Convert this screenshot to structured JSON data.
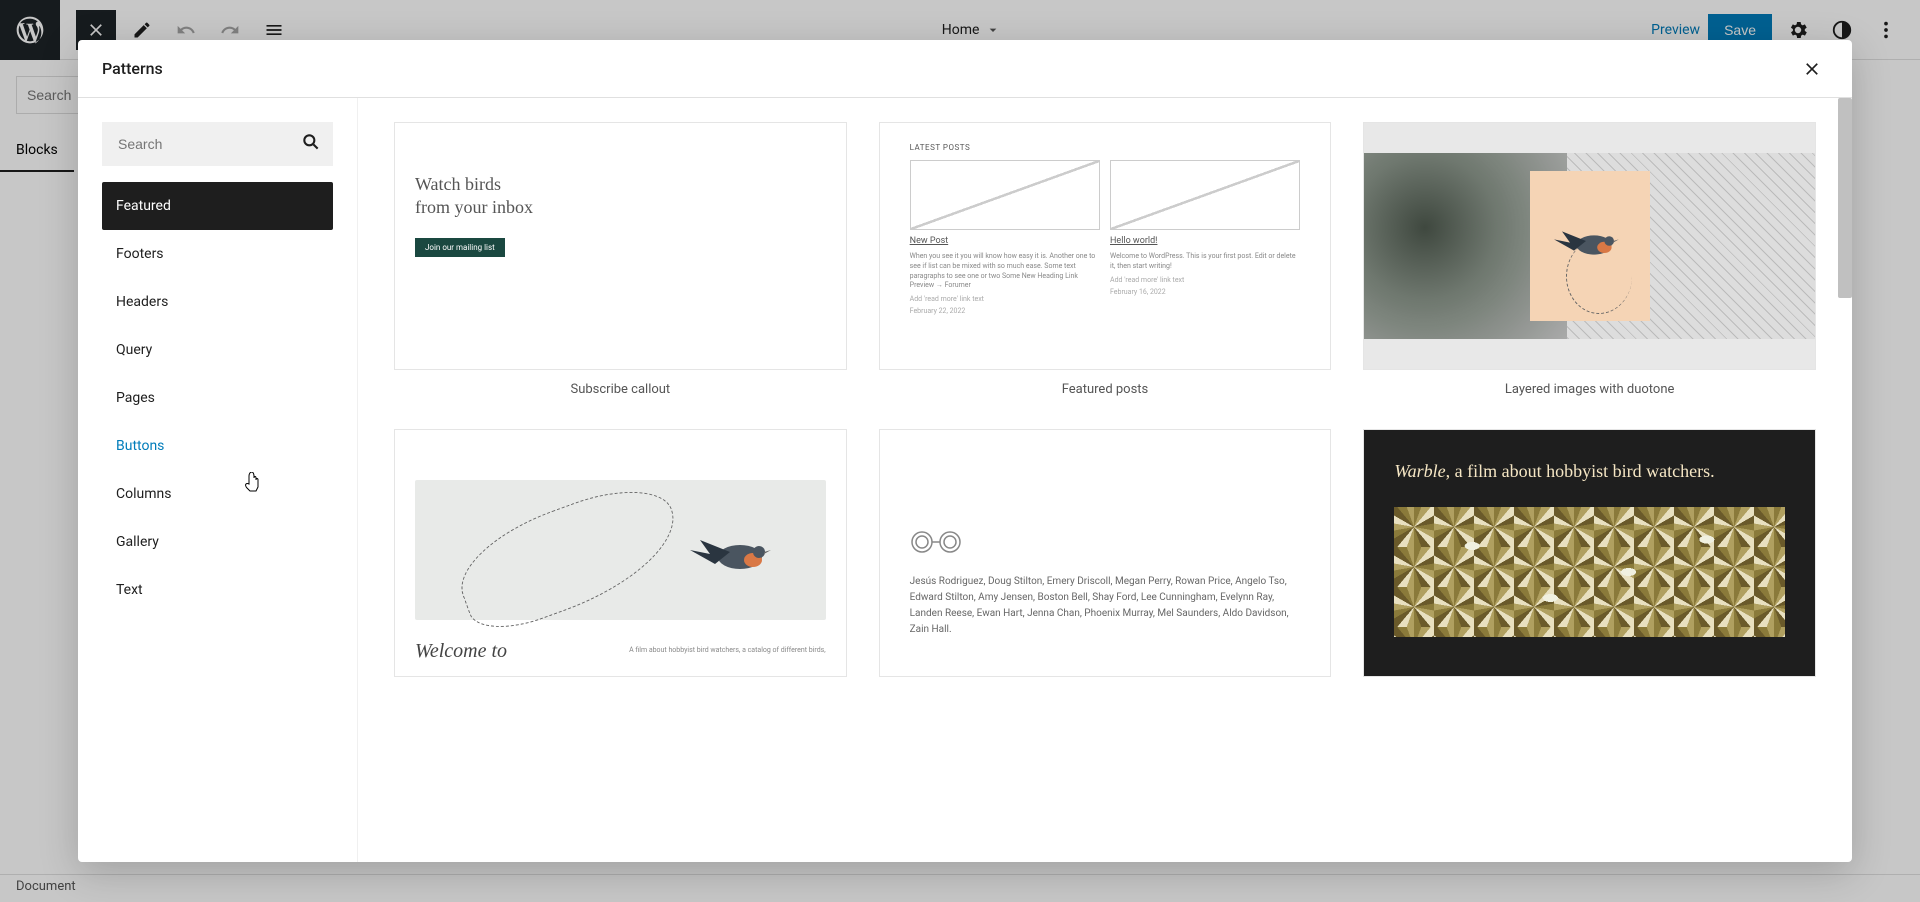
{
  "editor": {
    "page_title": "Home",
    "preview_label": "Preview",
    "save_label": "Save",
    "search_placeholder": "Search",
    "blocks_tab": "Blocks",
    "document_label": "Document",
    "new_post_bg": "New Post"
  },
  "modal": {
    "title": "Patterns",
    "search_placeholder": "Search",
    "categories": [
      {
        "label": "Featured",
        "active": true
      },
      {
        "label": "Footers"
      },
      {
        "label": "Headers"
      },
      {
        "label": "Query"
      },
      {
        "label": "Pages"
      },
      {
        "label": "Buttons",
        "hover": true
      },
      {
        "label": "Columns"
      },
      {
        "label": "Gallery"
      },
      {
        "label": "Text"
      }
    ],
    "patterns": [
      {
        "title": "Subscribe callout",
        "heading_l1": "Watch birds",
        "heading_l2": "from your inbox",
        "button": "Join our mailing list"
      },
      {
        "title": "Featured posts",
        "label": "LATEST POSTS",
        "col1": {
          "title": "New Post",
          "text": "When you see it you will know how easy it is. Another one to see if list can be mixed with so much ease. Some text paragraphs to see one or two Some New Heading Link Preview → Forumer",
          "link": "Add 'read more' link text",
          "date": "February 22, 2022"
        },
        "col2": {
          "title": "Hello world!",
          "text": "Welcome to WordPress. This is your first post. Edit or delete it, then start writing!",
          "link": "Add 'read more' link text",
          "date": "February 16, 2022"
        }
      },
      {
        "title": "Layered images with duotone"
      },
      {
        "title": "",
        "heading": "Welcome to",
        "text": "A film about hobbyist bird watchers, a catalog of different birds,"
      },
      {
        "title": "",
        "names": "Jesús Rodriguez, Doug Stilton, Emery Driscoll, Megan Perry, Rowan Price, Angelo Tso, Edward Stilton, Amy Jensen, Boston Bell, Shay Ford, Lee Cunningham, Evelynn Ray, Landen Reese, Ewan Hart, Jenna Chan, Phoenix Murray, Mel Saunders, Aldo Davidson, Zain Hall."
      },
      {
        "title": "",
        "heading_em": "Warble",
        "heading_rest": ", a film about hobbyist bird watchers."
      }
    ]
  }
}
